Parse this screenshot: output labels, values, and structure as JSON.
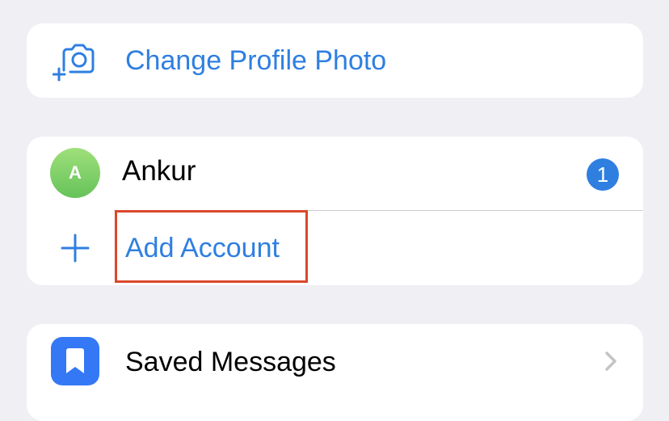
{
  "profile": {
    "change_photo_label": "Change Profile Photo"
  },
  "accounts": {
    "current": {
      "avatar_letter": "A",
      "name": "Ankur",
      "badge_count": "1"
    },
    "add_account_label": "Add Account"
  },
  "menu": {
    "saved_messages_label": "Saved Messages"
  },
  "icons": {
    "camera": "camera-add-icon",
    "plus": "plus-icon",
    "bookmark": "bookmark-icon",
    "chevron": "chevron-right-icon"
  },
  "colors": {
    "accent": "#2f7fe1",
    "background": "#efeff4",
    "highlight": "#d9482b",
    "avatar": "#7fd06a"
  }
}
